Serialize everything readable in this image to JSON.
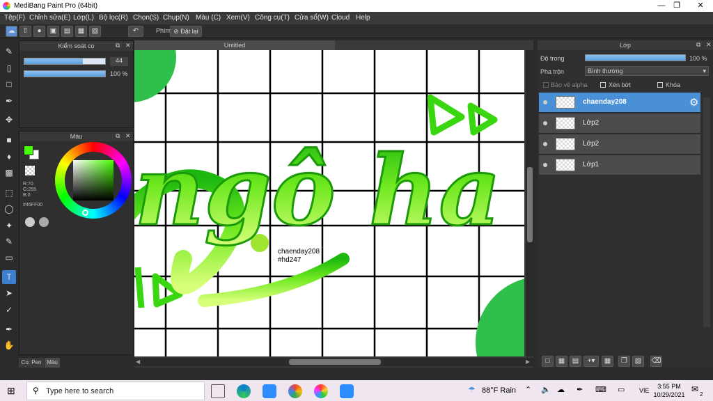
{
  "app": {
    "title": "MediBang Paint Pro (64bit)"
  },
  "menu": [
    "Tệp(F)",
    "Chỉnh sửa(E)",
    "Lớp(L)",
    "Bộ lọc(R)",
    "Chọn(S)",
    "Chụp(N)",
    "Màu (C)",
    "Xem(V)",
    "Công cụ(T)",
    "Cửa sổ(W)",
    "Cloud",
    "Help"
  ],
  "toolbar": {
    "shortcut_label": "Phím",
    "reset_label": "Đặt lại"
  },
  "brush_panel": {
    "title": "Kiểm soát cọ",
    "size_value": "44",
    "opacity_value": "100 %",
    "size_fraction": 0.72,
    "opacity_fraction": 1.0
  },
  "color_panel": {
    "title": "Màu",
    "r": "R:70",
    "g": "G:255",
    "b": "B:0",
    "hex": "#46FF00",
    "foreground": "#46FF00"
  },
  "bottom_tabs": [
    "Co: Pen",
    "Màu"
  ],
  "document": {
    "tab": "Untitled",
    "lettering": "ngô ha :)",
    "signature": "chaenday208",
    "signature2": "#hd247"
  },
  "layer_panel": {
    "title": "Lớp",
    "opacity_label": "Độ trong",
    "opacity_value": "100 %",
    "blend_label": "Pha trộn",
    "blend_value": "Bình thường",
    "protect_alpha": "Bảo vệ alpha",
    "clip": "Xén bớt",
    "lock": "Khóa",
    "layers": [
      {
        "name": "chaenday208",
        "selected": true
      },
      {
        "name": "Lớp2",
        "selected": false
      },
      {
        "name": "Lớp2",
        "selected": false
      },
      {
        "name": "Lớp1",
        "selected": false
      }
    ]
  },
  "taskbar": {
    "search_placeholder": "Type here to search",
    "weather": "88°F  Rain",
    "lang": "VIE",
    "time": "3:55 PM",
    "date": "10/29/2021",
    "notif": "2"
  }
}
